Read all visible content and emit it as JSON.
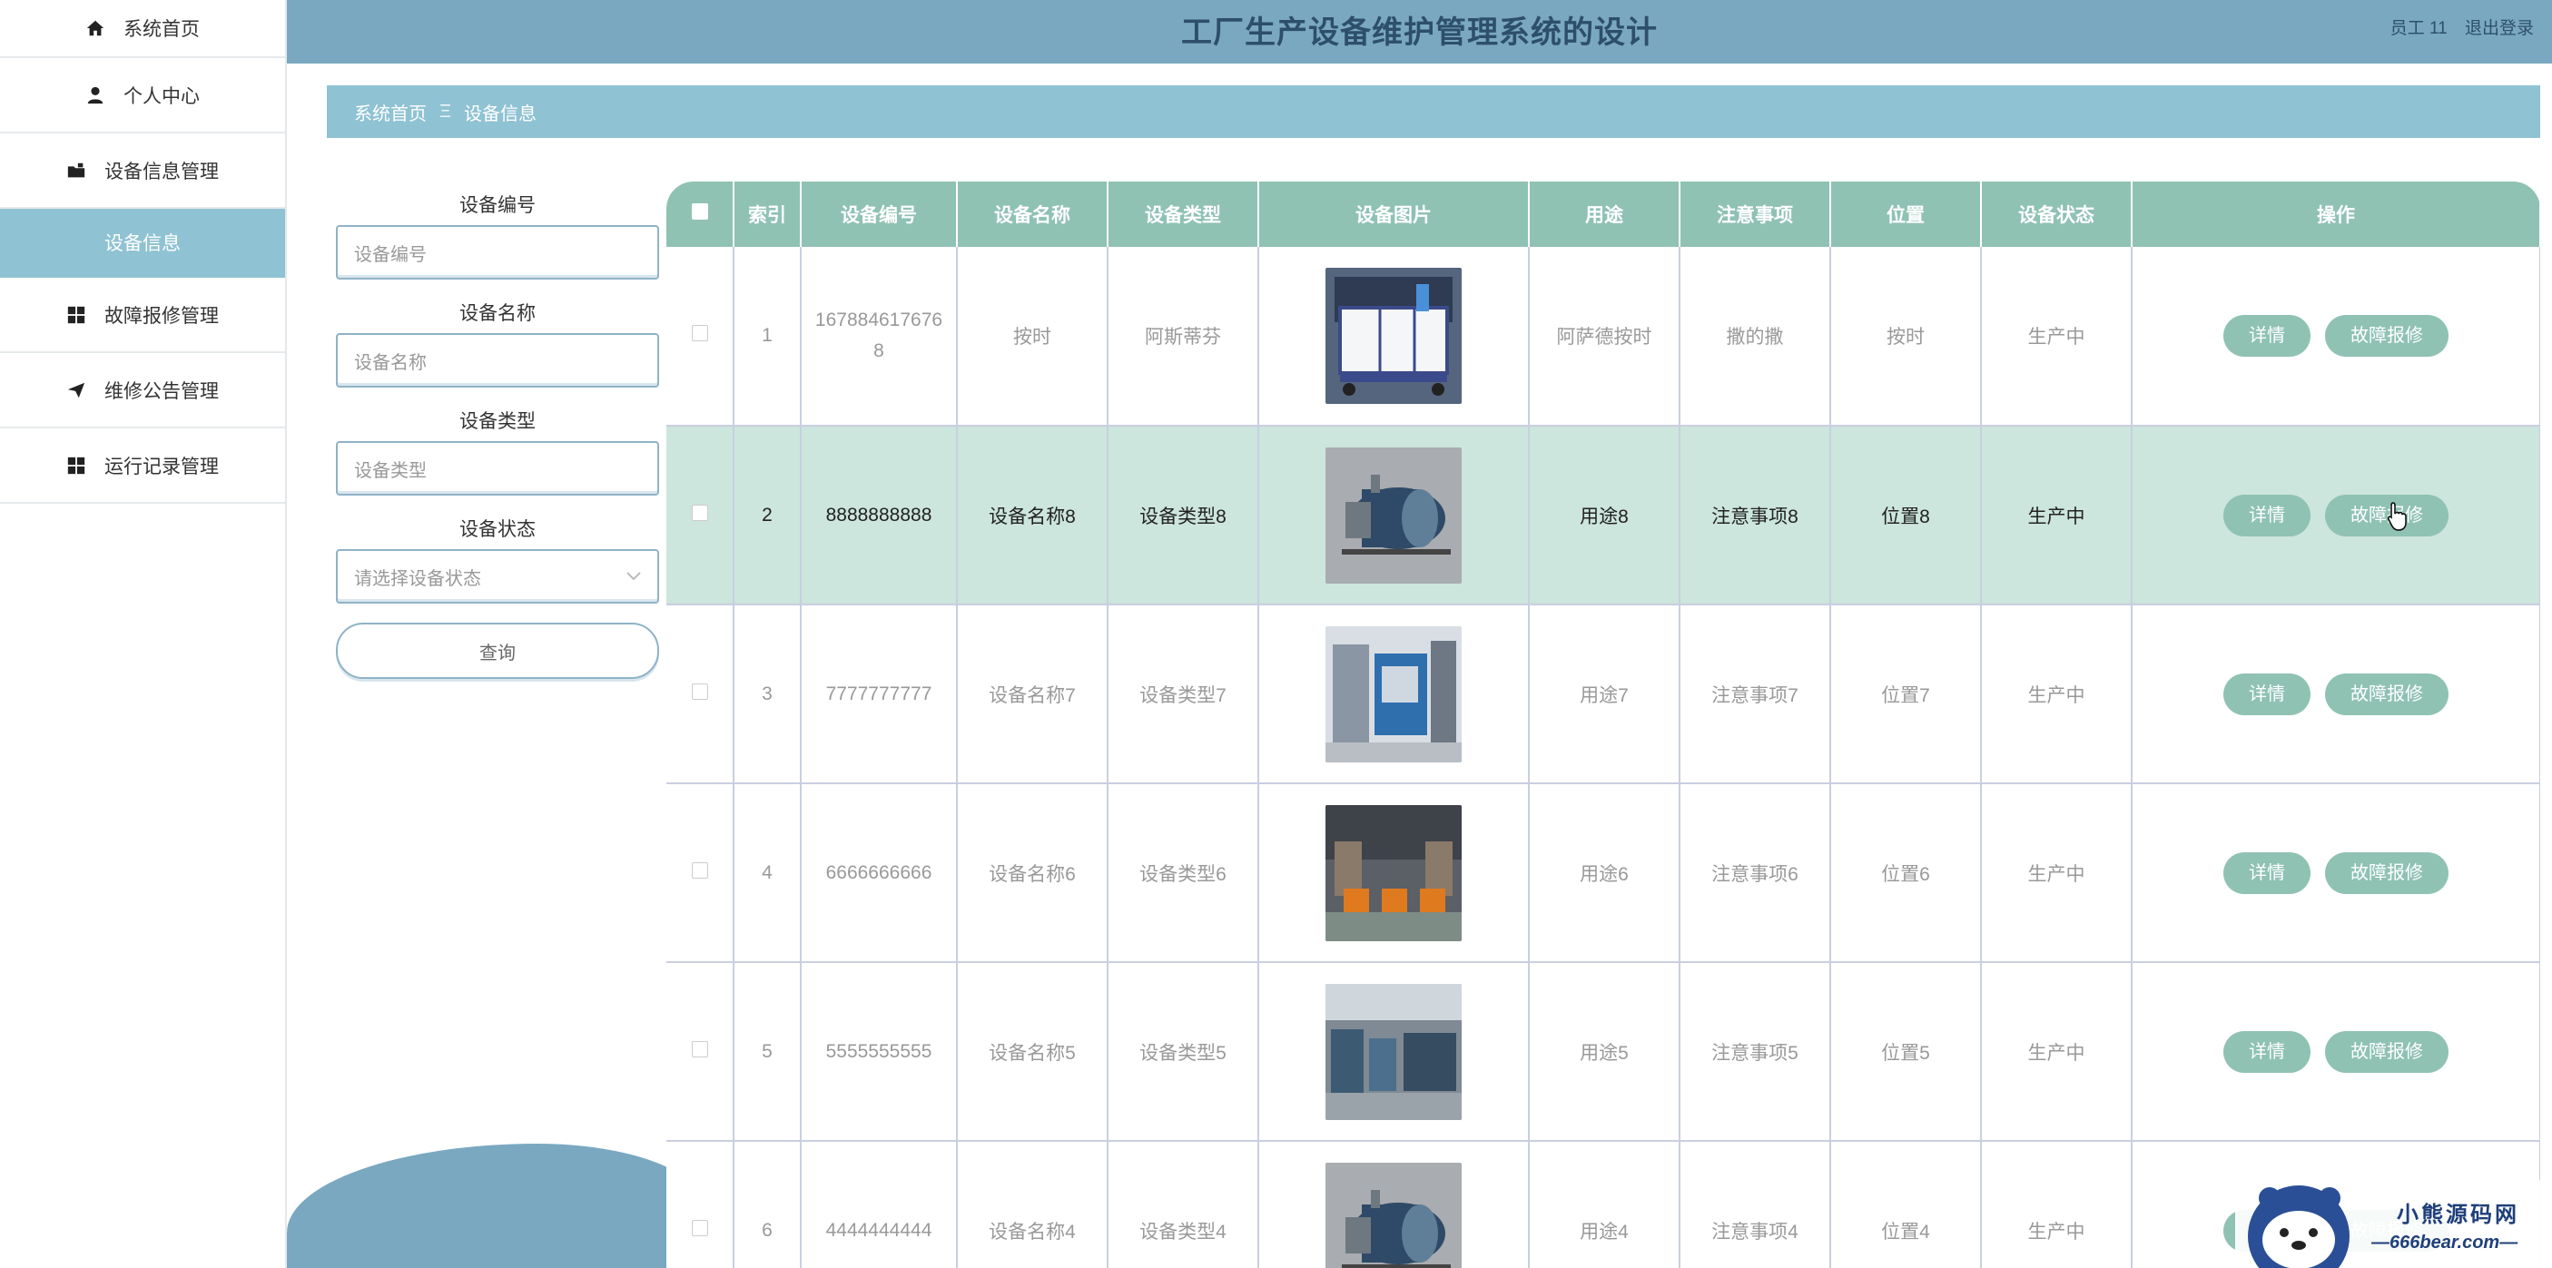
{
  "header": {
    "title": "工厂生产设备维护管理系统的设计",
    "user": "员工 11",
    "logout": "退出登录"
  },
  "sidebar": {
    "items": [
      {
        "label": "系统首页",
        "icon": "home-icon"
      },
      {
        "label": "个人中心",
        "icon": "user-icon"
      },
      {
        "label": "设备信息管理",
        "icon": "folder-icon"
      },
      {
        "label": "设备信息",
        "icon": ""
      },
      {
        "label": "故障报修管理",
        "icon": "grid-icon"
      },
      {
        "label": "维修公告管理",
        "icon": "send-icon"
      },
      {
        "label": "运行记录管理",
        "icon": "grid-icon"
      }
    ]
  },
  "breadcrumb": {
    "home": "系统首页",
    "sep": "Ξ",
    "current": "设备信息"
  },
  "search": {
    "code_label": "设备编号",
    "code_placeholder": "设备编号",
    "name_label": "设备名称",
    "name_placeholder": "设备名称",
    "type_label": "设备类型",
    "type_placeholder": "设备类型",
    "status_label": "设备状态",
    "status_placeholder": "请选择设备状态",
    "query_button": "查询"
  },
  "table": {
    "columns": [
      "索引",
      "设备编号",
      "设备名称",
      "设备类型",
      "设备图片",
      "用途",
      "注意事项",
      "位置",
      "设备状态",
      "操作"
    ],
    "rows": [
      {
        "index": "1",
        "code": "1678846176768",
        "name": "按时",
        "type": "阿斯蒂芬",
        "use": "阿萨德按时",
        "note": "撒的撒",
        "location": "按时",
        "status": "生产中",
        "pic": "tank"
      },
      {
        "index": "2",
        "code": "8888888888",
        "name": "设备名称8",
        "type": "设备类型8",
        "use": "用途8",
        "note": "注意事项8",
        "location": "位置8",
        "status": "生产中",
        "pic": "boiler"
      },
      {
        "index": "3",
        "code": "7777777777",
        "name": "设备名称7",
        "type": "设备类型7",
        "use": "用途7",
        "note": "注意事项7",
        "location": "位置7",
        "status": "生产中",
        "pic": "machine"
      },
      {
        "index": "4",
        "code": "6666666666",
        "name": "设备名称6",
        "type": "设备类型6",
        "use": "用途6",
        "note": "注意事项6",
        "location": "位置6",
        "status": "生产中",
        "pic": "factory"
      },
      {
        "index": "5",
        "code": "5555555555",
        "name": "设备名称5",
        "type": "设备类型5",
        "use": "用途5",
        "note": "注意事项5",
        "location": "位置5",
        "status": "生产中",
        "pic": "workshop"
      },
      {
        "index": "6",
        "code": "4444444444",
        "name": "设备名称4",
        "type": "设备类型4",
        "use": "用途4",
        "note": "注意事项4",
        "location": "位置4",
        "status": "生产中",
        "pic": "boiler"
      }
    ],
    "detail_button": "详情",
    "repair_button": "故障报修"
  },
  "watermark": {
    "text": "小熊源码网",
    "url": "—666bear.com—"
  },
  "colors": {
    "accent": "#8fc2b3",
    "header": "#7aa8c0",
    "crumb": "#8fc2d3"
  }
}
